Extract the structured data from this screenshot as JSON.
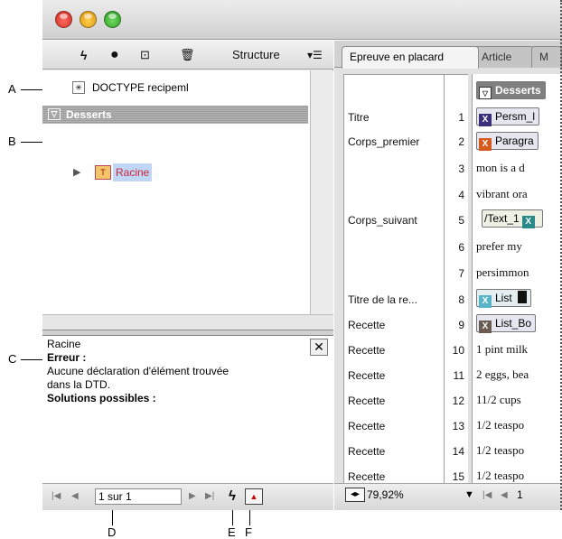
{
  "callouts": {
    "a": "A",
    "b": "B",
    "c": "C",
    "d": "D",
    "e": "E",
    "f": "F"
  },
  "structure_panel": {
    "title": "Structure",
    "doctype": "DOCTYPE recipeml",
    "root_element": "Desserts",
    "child_element": "Racine",
    "info": {
      "element": "Racine",
      "error_label": "Erreur :",
      "error_line1": "Aucune déclaration d'élément trouvée",
      "error_line2": "dans la DTD.",
      "solutions_label": "Solutions possibles :"
    },
    "pager": {
      "value": "1 sur 1"
    }
  },
  "story_editor": {
    "tabs": [
      "Epreuve en placard",
      "Article",
      "M"
    ],
    "zoom": "79,92%",
    "page": "1",
    "rows": [
      {
        "style": "",
        "line": ""
      },
      {
        "style": "Titre",
        "line": "1"
      },
      {
        "style": "Corps_premier",
        "line": "2"
      },
      {
        "style": "",
        "line": "3"
      },
      {
        "style": "",
        "line": "4"
      },
      {
        "style": "Corps_suivant",
        "line": "5"
      },
      {
        "style": "",
        "line": "6"
      },
      {
        "style": "",
        "line": "7"
      },
      {
        "style": "Titre de la re...",
        "line": "8"
      },
      {
        "style": "Recette",
        "line": "9"
      },
      {
        "style": "Recette",
        "line": "10"
      },
      {
        "style": "Recette",
        "line": "11"
      },
      {
        "style": "Recette",
        "line": "12"
      },
      {
        "style": "Recette",
        "line": "13"
      },
      {
        "style": "Recette",
        "line": "14"
      },
      {
        "style": "Recette",
        "line": "15"
      }
    ],
    "text": {
      "t0": "Desserts",
      "t1": "Persm_l",
      "t2": "Paragra",
      "t3": "mon is a d",
      "t4": "vibrant ora",
      "t5": "/Text_1",
      "t6": "prefer my",
      "t7": "persimmon",
      "t8": "List",
      "t9": "List_Bo",
      "t10": "1 pint milk",
      "t11": "2 eggs, bea",
      "t12": "11/2 cups",
      "t13": "1/2 teaspo",
      "t14": "1/2 teaspo",
      "t15": "1/2 teaspo"
    }
  }
}
